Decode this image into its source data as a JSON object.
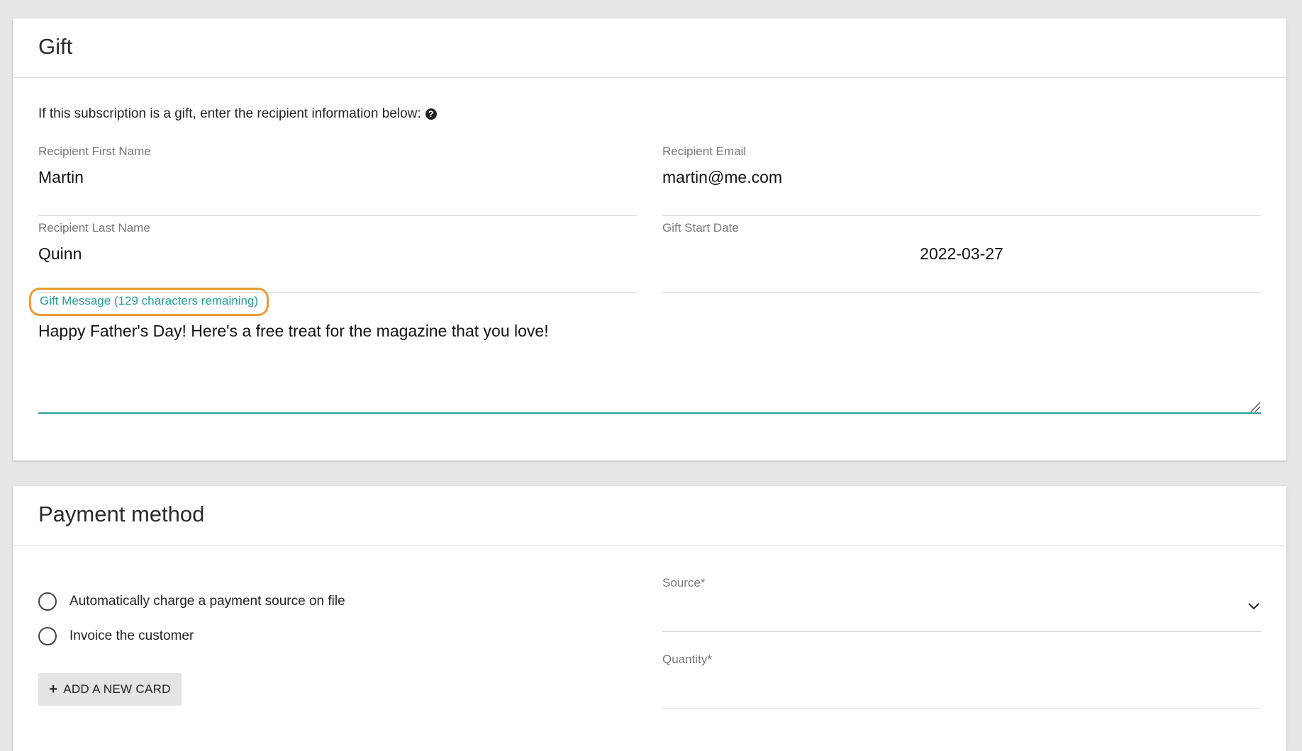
{
  "gift": {
    "title": "Gift",
    "intro": "If this subscription is a gift, enter the recipient information below:",
    "help_icon": "question-circle-icon",
    "first_name": {
      "label": "Recipient First Name",
      "value": "Martin"
    },
    "email": {
      "label": "Recipient Email",
      "value": "martin@me.com"
    },
    "last_name": {
      "label": "Recipient Last Name",
      "value": "Quinn"
    },
    "start_date": {
      "label": "Gift Start Date",
      "value": "2022-03-27"
    },
    "message": {
      "label": "Gift Message (129 characters remaining)",
      "value": "Happy Father's Day! Here's a free treat for the magazine that you love!"
    }
  },
  "payment": {
    "title": "Payment method",
    "options": [
      {
        "label": "Automatically charge a payment source on file",
        "selected": false
      },
      {
        "label": "Invoice the customer",
        "selected": false
      }
    ],
    "add_card_label": "ADD A NEW CARD",
    "source": {
      "label": "Source*",
      "value": ""
    },
    "quantity": {
      "label": "Quantity*",
      "value": ""
    }
  },
  "colors": {
    "accent": "#2a9d95",
    "highlight": "#ec9a36",
    "background": "#e6e7e7"
  }
}
